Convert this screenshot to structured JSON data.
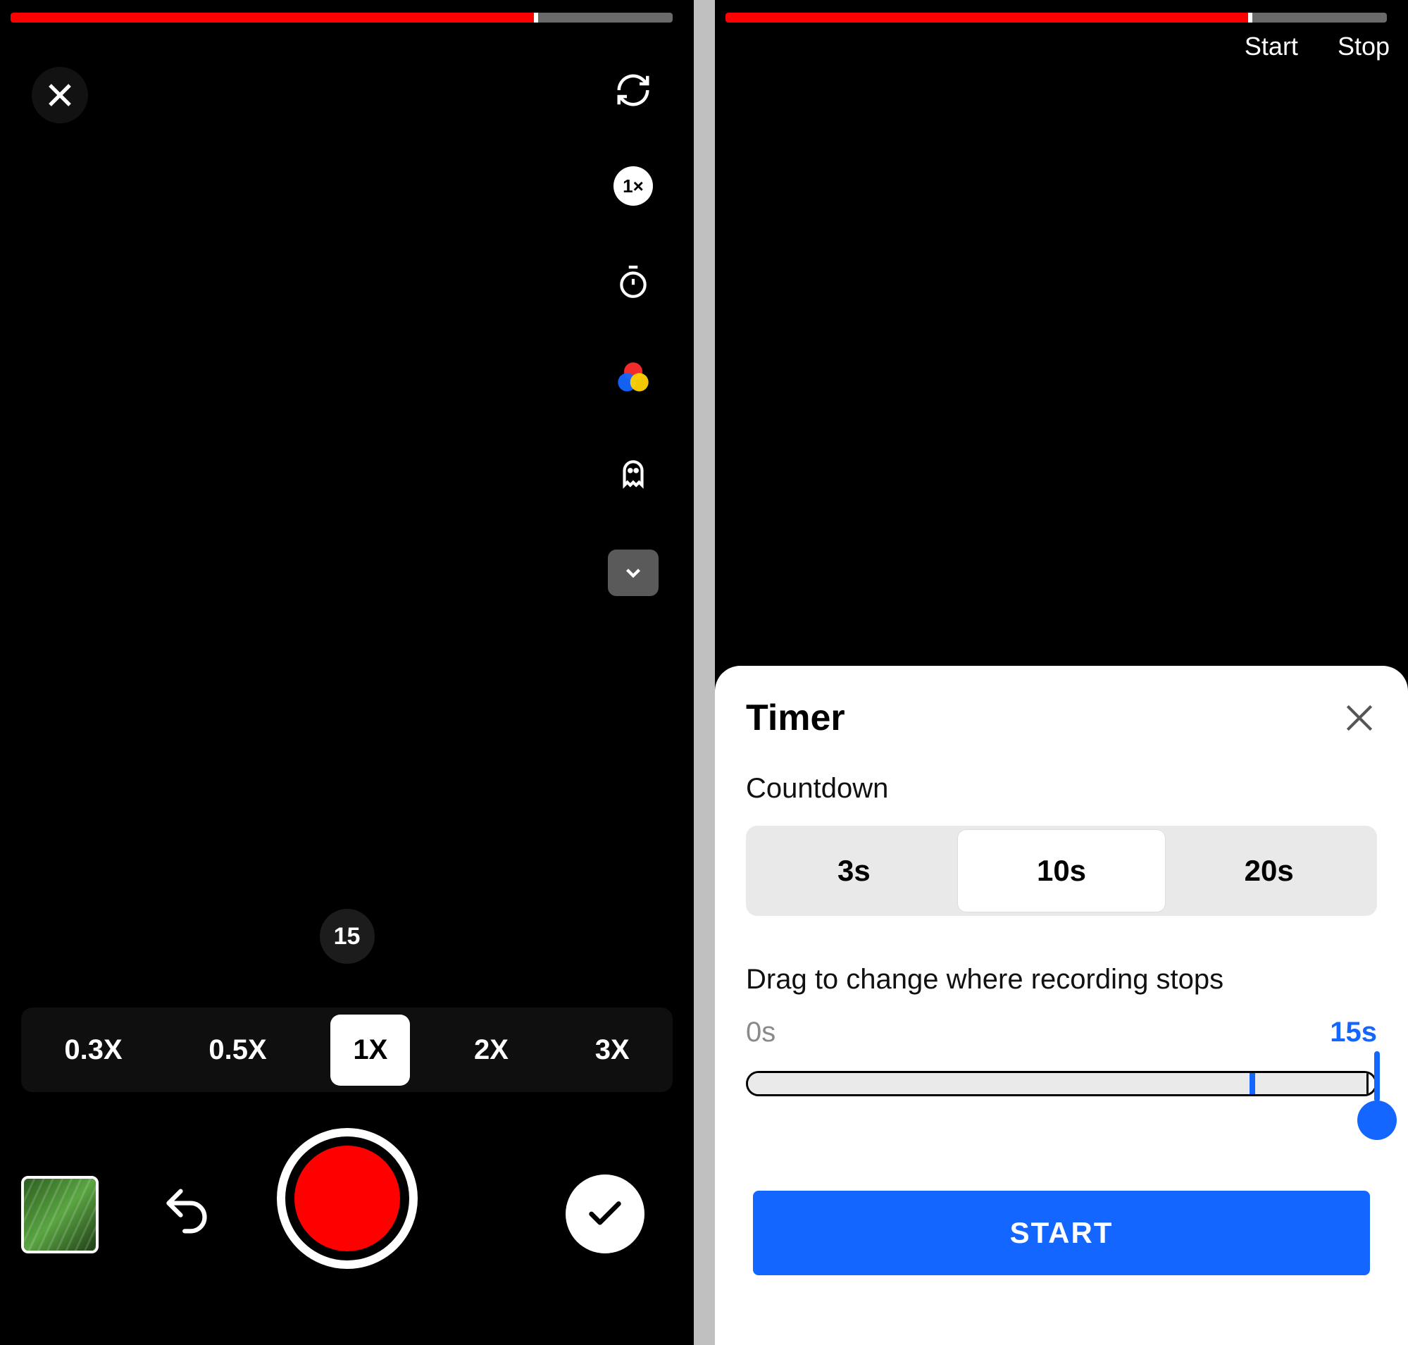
{
  "progress": {
    "filled_pct_left": 79,
    "filled_pct_right": 79
  },
  "left": {
    "duration_label": "15",
    "speed_badge": "1×",
    "zoom_options": [
      "0.3X",
      "0.5X",
      "1X",
      "2X",
      "3X"
    ],
    "zoom_selected_index": 2
  },
  "right": {
    "top_start": "Start",
    "top_stop": "Stop"
  },
  "timer_sheet": {
    "title": "Timer",
    "countdown_label": "Countdown",
    "countdown_options": [
      "3s",
      "10s",
      "20s"
    ],
    "countdown_selected_index": 1,
    "drag_label": "Drag to change where recording stops",
    "range_min": "0s",
    "range_max": "15s",
    "existing_mark_pct": 80,
    "handle_pct": 100,
    "start_button": "START"
  }
}
